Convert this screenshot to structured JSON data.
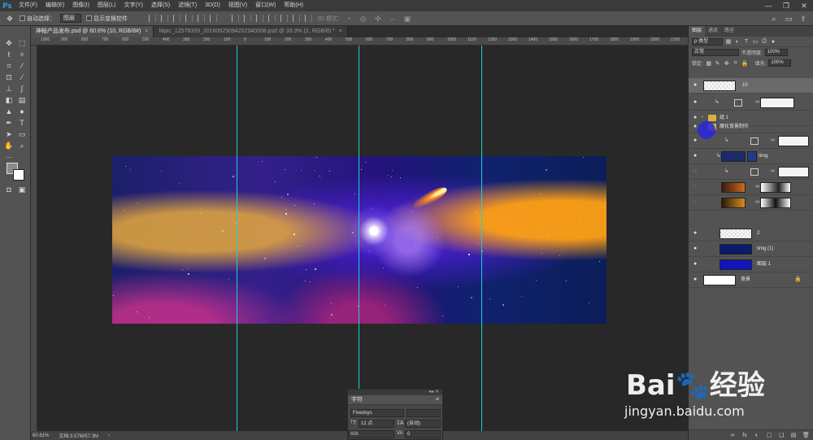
{
  "app": {
    "logo": "Ps",
    "menu": [
      "文件(F)",
      "编辑(E)",
      "图像(I)",
      "图层(L)",
      "文字(Y)",
      "选择(S)",
      "滤镜(T)",
      "3D(D)",
      "视图(V)",
      "窗口(W)",
      "帮助(H)"
    ],
    "window_controls": [
      "—",
      "❐",
      "✕"
    ]
  },
  "options": {
    "auto_select_label": "自动选择：",
    "auto_select_value": "图层",
    "show_transform_label": "显示变换控件",
    "mode_3d_label": "3D 模式:"
  },
  "tabs": [
    {
      "label": "神秘产品发布.psd @ 60.6% (10, RGB/8#)",
      "close": "×",
      "active": true
    },
    {
      "label": "Nipic_12578339_20160625094202340008.psd @ 33.3% (2, RGB/8) *",
      "close": "×",
      "active": false
    }
  ],
  "ruler_ticks": [
    "1000",
    "900",
    "800",
    "700",
    "600",
    "500",
    "400",
    "300",
    "200",
    "100",
    "0",
    "100",
    "200",
    "300",
    "400",
    "500",
    "600",
    "700",
    "800",
    "900",
    "1000",
    "1100",
    "1200",
    "1300",
    "1400",
    "1500",
    "1600",
    "1700",
    "1800",
    "1900",
    "2000",
    "2100",
    "2200",
    "2300"
  ],
  "status": {
    "zoom": "60.61%",
    "doc": "文档:3.57M/57.3M",
    "arrow": "›"
  },
  "char_panel": {
    "collapse": "◂◂ ✕",
    "tab": "字符",
    "font": "Fixedsys",
    "size": "12 点",
    "leading": "(自动)",
    "kerning": "V/A",
    "tracking": "0"
  },
  "right_panel": {
    "tabs": [
      "图层",
      "通道",
      "路径"
    ],
    "filter_label": "ρ 类型",
    "blend_mode": "正常",
    "opacity_label": "不透明度:",
    "opacity_value": "100%",
    "lock_label": "锁定:",
    "fill_label": "填充:",
    "fill_value": "100%",
    "layers": [
      {
        "name": "10"
      },
      {
        "name": ""
      },
      {
        "name": "组 1"
      },
      {
        "name": "魔化背景制作"
      },
      {
        "name": ""
      },
      {
        "name": "timg"
      },
      {
        "name": ""
      },
      {
        "name": ""
      },
      {
        "name": ""
      },
      {
        "name": "2"
      },
      {
        "name": "timg (1)"
      },
      {
        "name": "图层 1"
      },
      {
        "name": "背景"
      }
    ],
    "bottom_icons": [
      "fx",
      "◐",
      "▢",
      "❏",
      "▤",
      "🗑"
    ]
  },
  "watermark": {
    "main": "Bai🐾经验",
    "sub": "jingyan.baidu.com"
  },
  "colors": {
    "guide": "#1fd0d0",
    "accent": "#31a8ff",
    "selection_cursor": "#2828dc"
  }
}
